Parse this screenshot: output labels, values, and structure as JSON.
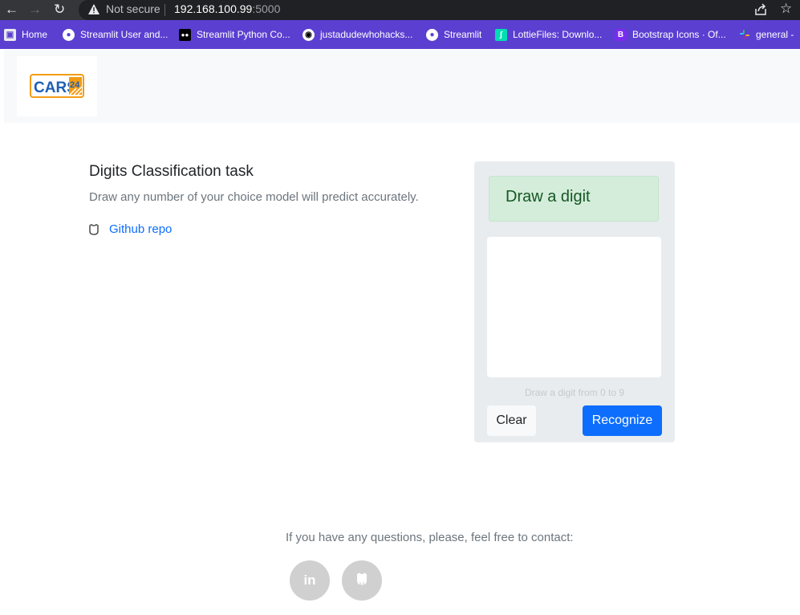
{
  "browser": {
    "security_label": "Not secure",
    "url_host": "192.168.100.99",
    "url_port": ":5000"
  },
  "bookmarks": [
    {
      "label": "Home",
      "icon": "home-icon"
    },
    {
      "label": "Streamlit User and...",
      "icon": "globe-icon"
    },
    {
      "label": "Streamlit Python Co...",
      "icon": "medium-icon"
    },
    {
      "label": "justadudewhohacks...",
      "icon": "github-icon"
    },
    {
      "label": "Streamlit",
      "icon": "globe-icon"
    },
    {
      "label": "LottieFiles: Downlo...",
      "icon": "lottiefiles-icon"
    },
    {
      "label": "Bootstrap Icons · Of...",
      "icon": "bootstrap-icon"
    },
    {
      "label": "general -",
      "icon": "slack-icon"
    }
  ],
  "header": {
    "logo_text": "CARS",
    "logo_number": "24"
  },
  "intro": {
    "title": "Digits Classification task",
    "subtitle": "Draw any number of your choice model will predict accurately.",
    "repo_link": "Github repo"
  },
  "panel": {
    "alert": "Draw a digit",
    "hint": "Draw a digit from 0 to 9",
    "clear_label": "Clear",
    "recognize_label": "Recognize"
  },
  "footer": {
    "contact": "If you have any questions, please, feel free to contact:",
    "socials": [
      {
        "label": "in",
        "icon": "linkedin-icon"
      },
      {
        "label": "github",
        "icon": "github-icon"
      }
    ]
  },
  "colors": {
    "bookmark_bar": "#5b3fd1",
    "primary": "#0d6efd",
    "alert_bg": "#d4edda",
    "alert_text": "#155724",
    "logo_blue": "#1e5fb4",
    "logo_orange": "#f39c12"
  }
}
